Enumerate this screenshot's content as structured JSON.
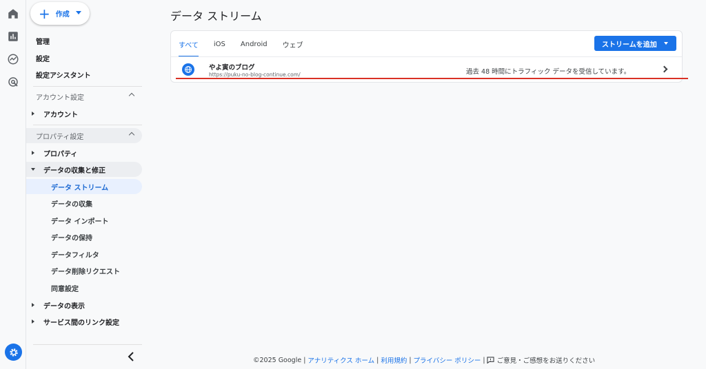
{
  "rail": {
    "icons": [
      "home-icon",
      "reports-icon",
      "explore-icon",
      "advertising-icon"
    ],
    "settings_icon": "gear-icon"
  },
  "nav": {
    "create_label": "作成",
    "items": {
      "manage": "管理",
      "settings": "設定",
      "setup_assistant": "設定アシスタント",
      "account_settings": "アカウント設定",
      "account": "アカウント",
      "property_settings": "プロパティ設定",
      "property": "プロパティ",
      "data_collection_modification": "データの収集と修正",
      "data_streams": "データ ストリーム",
      "data_collection": "データの収集",
      "data_import": "データ インポート",
      "data_retention": "データの保持",
      "data_filters": "データフィルタ",
      "data_deletion_requests": "データ削除リクエスト",
      "consent_settings": "同意設定",
      "data_display": "データの表示",
      "product_links": "サービス間のリンク設定"
    }
  },
  "main": {
    "title": "データ ストリーム",
    "tabs": [
      "すべて",
      "iOS",
      "Android",
      "ウェブ"
    ],
    "add_stream_label": "ストリームを追加",
    "stream": {
      "name": "やよ寅のブログ",
      "url": "https://puku-no-blog-continue.com/",
      "status": "過去 48 時間にトラフィック データを受信しています。"
    }
  },
  "footer": {
    "copyright": "©2025 Google |",
    "analytics_home": "アナリティクス ホーム",
    "sep1": "|",
    "terms": "利用規約",
    "sep2": "|",
    "privacy": "プライバシー ポリシー",
    "sep3": "|",
    "feedback": "ご意見・ご感想をお送りください"
  },
  "colors": {
    "accent": "#1a73e8",
    "active_bg": "#e8f0fe",
    "highlight_line": "#d93025"
  }
}
